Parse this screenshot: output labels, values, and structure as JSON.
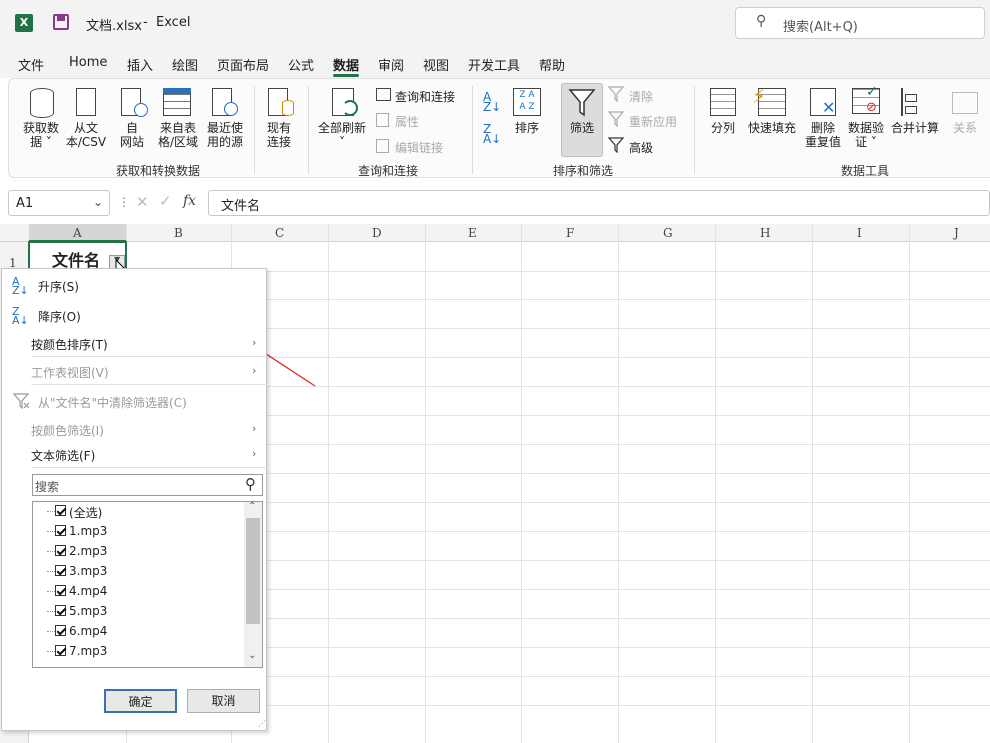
{
  "title_bar": {
    "filename": "文档.xlsx",
    "sep": "-",
    "app": "Excel",
    "search_placeholder": "搜索(Alt+Q)"
  },
  "menu_tabs": [
    "文件",
    "Home",
    "插入",
    "绘图",
    "页面布局",
    "公式",
    "数据",
    "审阅",
    "视图",
    "开发工具",
    "帮助"
  ],
  "active_tab": "数据",
  "ribbon": {
    "get_data": "获取数\n据 ˅",
    "from_text": "从文\n本/CSV",
    "from_web": "自\n网站",
    "from_table": "来自表\n格/区域",
    "recent_sources": "最近使\n用的源",
    "existing_conn": "现有\n连接",
    "group_get": "获取和转换数据",
    "refresh_all": "全部刷新\n˅",
    "queries_conn": "查询和连接",
    "properties": "属性",
    "edit_links": "编辑链接",
    "group_queries": "查询和连接",
    "sort": "排序",
    "filter": "筛选",
    "clear": "清除",
    "reapply": "重新应用",
    "advanced": "高级",
    "group_sort": "排序和筛选",
    "split": "分列",
    "flash_fill": "快速填充",
    "remove_dup": "删除\n重复值",
    "data_validation": "数据验\n证 ˅",
    "consolidate": "合并计算",
    "relations": "关系",
    "group_tools": "数据工具"
  },
  "formula_bar": {
    "cell_ref": "A1",
    "content": "文件名"
  },
  "columns": [
    "A",
    "B",
    "C",
    "D",
    "E",
    "F",
    "G",
    "H",
    "I",
    "J"
  ],
  "row_numbers": [
    "1"
  ],
  "cell_a1": "文件名",
  "filter_menu": {
    "sort_asc": "升序(S)",
    "sort_desc": "降序(O)",
    "sort_by_color": "按颜色排序(T)",
    "sheet_view": "工作表视图(V)",
    "clear_filter": "从\"文件名\"中清除筛选器(C)",
    "filter_by_color": "按颜色筛选(I)",
    "text_filter": "文本筛选(F)",
    "search_placeholder": "搜索",
    "items": [
      "(全选)",
      "1.mp3",
      "2.mp3",
      "3.mp3",
      "4.mp4",
      "5.mp3",
      "6.mp4",
      "7.mp3"
    ],
    "ok": "确定",
    "cancel": "取消"
  },
  "colors": {
    "excel_green": "#217346",
    "annotation_red": "#e03030",
    "selected_button": "#dcdcdc"
  }
}
